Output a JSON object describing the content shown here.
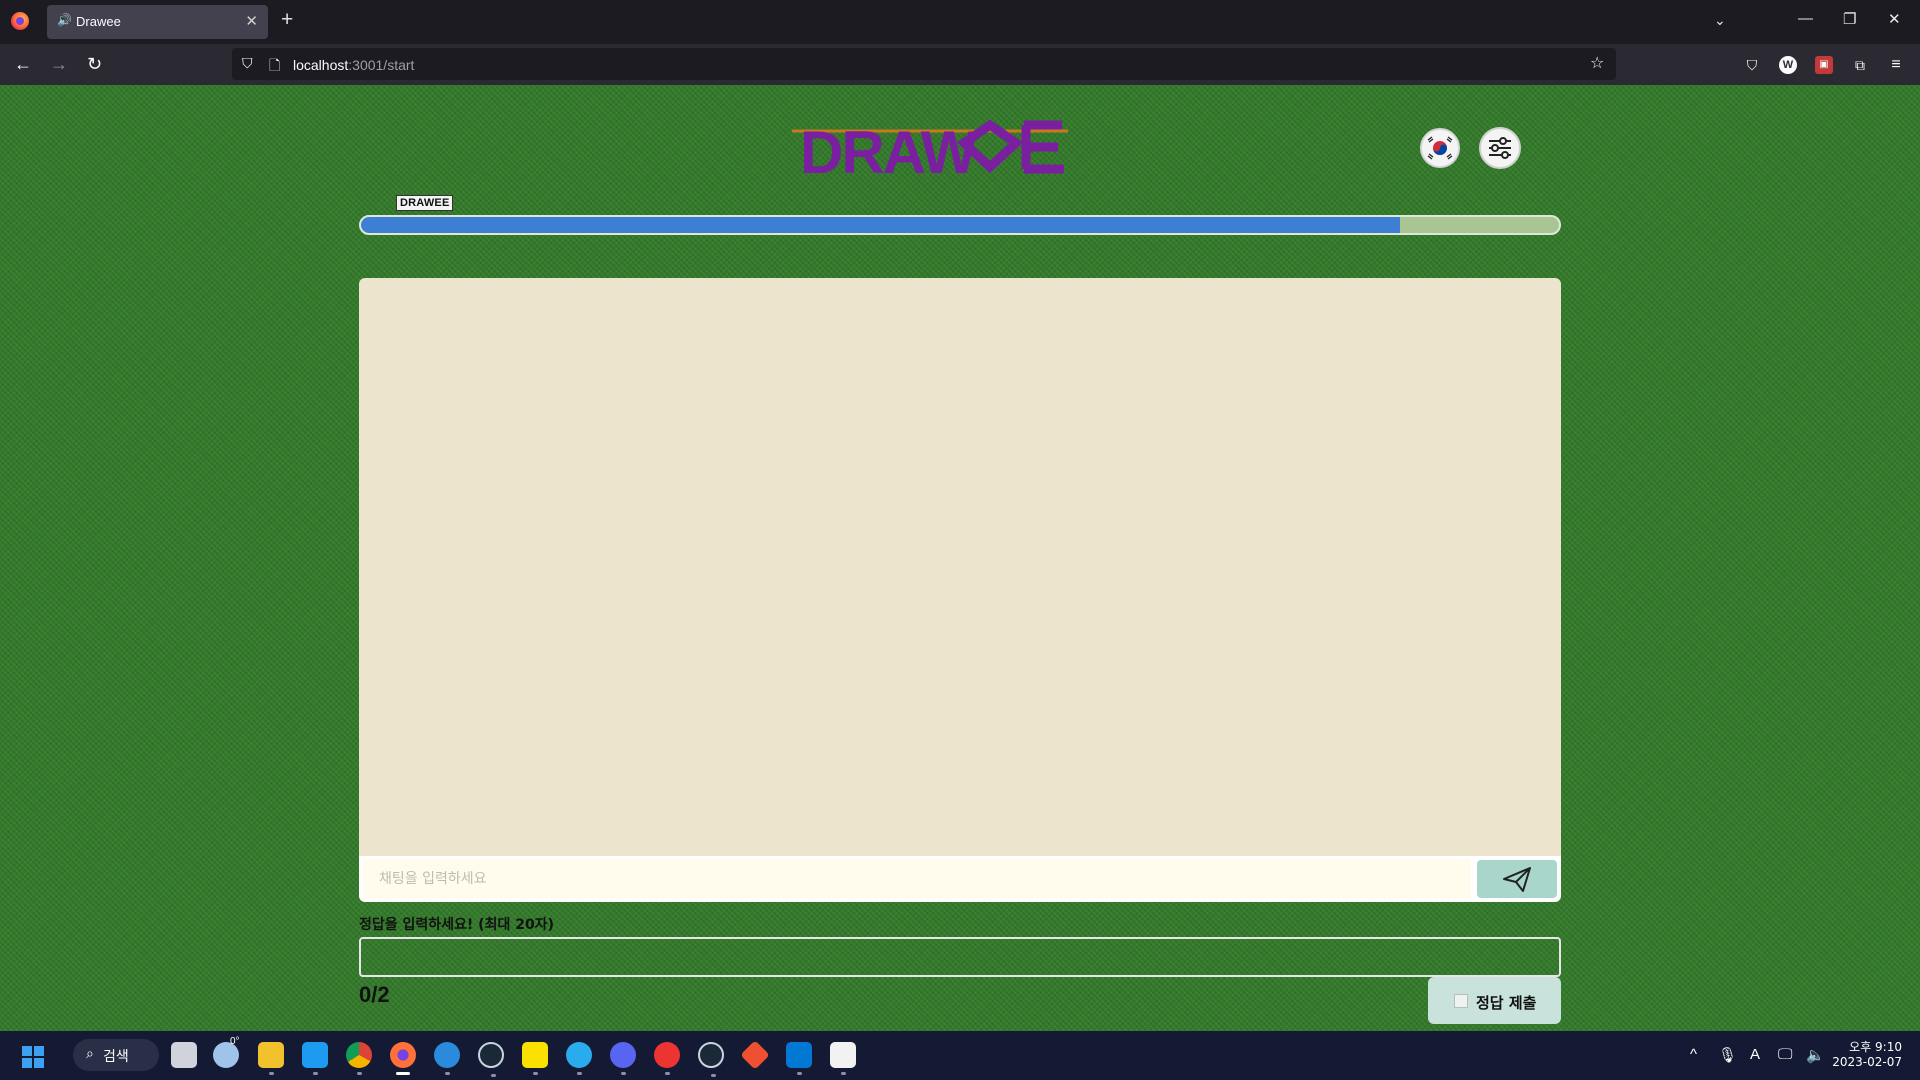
{
  "browser": {
    "tab_title": "Drawee",
    "url_host": "localhost",
    "url_path": ":3001/start",
    "new_tab_glyph": "+"
  },
  "page": {
    "logo_text": "DRAWEE",
    "badge_label": "DRAWEE",
    "progress": 0.867,
    "chat_placeholder": "채팅을 입력하세요",
    "answer_label": "정답을 입력하세요! (최대 20자)",
    "answer_value": "",
    "answer_count": "0/2",
    "submit_label": "정답 제출",
    "colors": {
      "background": "#327a2a",
      "canvas": "#ece4cc",
      "progress_fill": "#3d7fd3",
      "progress_track": "#a9c594",
      "send_button": "#a8d6cb",
      "logo": "#7a1fa0"
    },
    "icons": [
      "korea-flag-icon",
      "settings-sliders-icon",
      "send-paper-plane-icon"
    ]
  },
  "taskbar": {
    "search_label": "검색",
    "weather_temp": "0°",
    "time": "오후 9:10",
    "date": "2023-02-07",
    "ime": "A",
    "apps": [
      "file-explorer",
      "twitter",
      "chrome",
      "firefox",
      "edge-dev",
      "steam",
      "kakaotalk",
      "telegram",
      "discord",
      "youtube-music",
      "steam-alt",
      "git",
      "vscode",
      "snipping-tool"
    ]
  }
}
